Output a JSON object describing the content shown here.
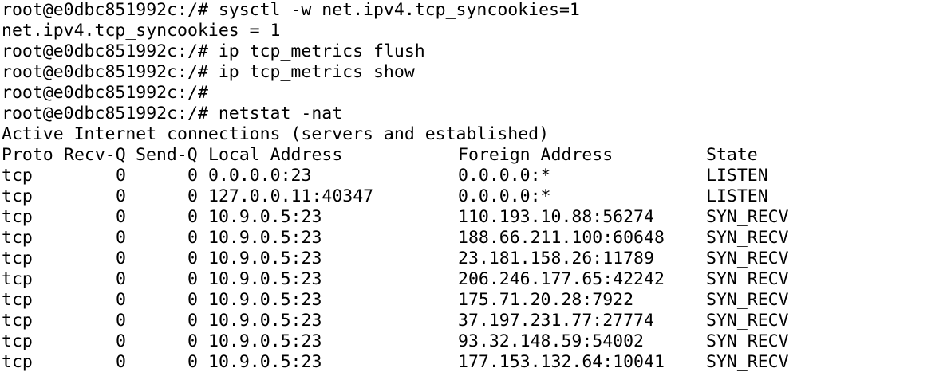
{
  "terminal": {
    "prompt": "root@e0dbc851992c:/# ",
    "history": [
      {
        "kind": "cmd",
        "text": "sysctl -w net.ipv4.tcp_syncookies=1"
      },
      {
        "kind": "out",
        "text": "net.ipv4.tcp_syncookies = 1"
      },
      {
        "kind": "cmd",
        "text": "ip tcp_metrics flush"
      },
      {
        "kind": "cmd",
        "text": "ip tcp_metrics show"
      },
      {
        "kind": "cmd",
        "text": ""
      },
      {
        "kind": "cmd",
        "text": "netstat -nat"
      },
      {
        "kind": "out",
        "text": "Active Internet connections (servers and established)"
      }
    ],
    "netstat": {
      "headers": {
        "proto": "Proto",
        "recvq": "Recv-Q",
        "sendq": "Send-Q",
        "local": "Local Address",
        "foreign": "Foreign Address",
        "state": "State"
      },
      "rows": [
        {
          "proto": "tcp",
          "recvq": "0",
          "sendq": "0",
          "local": "0.0.0.0:23",
          "foreign": "0.0.0.0:*",
          "state": "LISTEN"
        },
        {
          "proto": "tcp",
          "recvq": "0",
          "sendq": "0",
          "local": "127.0.0.11:40347",
          "foreign": "0.0.0.0:*",
          "state": "LISTEN"
        },
        {
          "proto": "tcp",
          "recvq": "0",
          "sendq": "0",
          "local": "10.9.0.5:23",
          "foreign": "110.193.10.88:56274",
          "state": "SYN_RECV"
        },
        {
          "proto": "tcp",
          "recvq": "0",
          "sendq": "0",
          "local": "10.9.0.5:23",
          "foreign": "188.66.211.100:60648",
          "state": "SYN_RECV"
        },
        {
          "proto": "tcp",
          "recvq": "0",
          "sendq": "0",
          "local": "10.9.0.5:23",
          "foreign": "23.181.158.26:11789",
          "state": "SYN_RECV"
        },
        {
          "proto": "tcp",
          "recvq": "0",
          "sendq": "0",
          "local": "10.9.0.5:23",
          "foreign": "206.246.177.65:42242",
          "state": "SYN_RECV"
        },
        {
          "proto": "tcp",
          "recvq": "0",
          "sendq": "0",
          "local": "10.9.0.5:23",
          "foreign": "175.71.20.28:7922",
          "state": "SYN_RECV"
        },
        {
          "proto": "tcp",
          "recvq": "0",
          "sendq": "0",
          "local": "10.9.0.5:23",
          "foreign": "37.197.231.77:27774",
          "state": "SYN_RECV"
        },
        {
          "proto": "tcp",
          "recvq": "0",
          "sendq": "0",
          "local": "10.9.0.5:23",
          "foreign": "93.32.148.59:54002",
          "state": "SYN_RECV"
        },
        {
          "proto": "tcp",
          "recvq": "0",
          "sendq": "0",
          "local": "10.9.0.5:23",
          "foreign": "177.153.132.64:10041",
          "state": "SYN_RECV"
        }
      ]
    },
    "colors": {
      "background": "#ffffff",
      "foreground": "#000000"
    }
  }
}
